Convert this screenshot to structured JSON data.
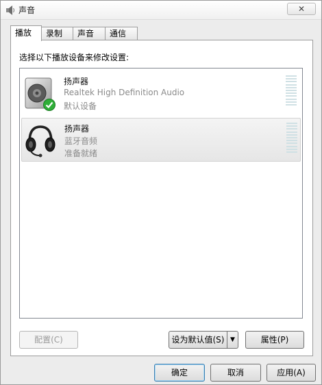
{
  "window": {
    "title": "声音",
    "close_label": "✕"
  },
  "tabs": [
    {
      "label": "播放",
      "active": true
    },
    {
      "label": "录制",
      "active": false
    },
    {
      "label": "声音",
      "active": false
    },
    {
      "label": "通信",
      "active": false
    }
  ],
  "panel": {
    "instruction": "选择以下播放设备来修改设置:"
  },
  "devices": [
    {
      "name": "扬声器",
      "description": "Realtek High Definition Audio",
      "status": "默认设备",
      "icon": "speaker-icon",
      "default": true
    },
    {
      "name": "扬声器",
      "description": "蓝牙音频",
      "status": "准备就绪",
      "icon": "headset-icon",
      "default": false
    }
  ],
  "buttons": {
    "configure": "配置(C)",
    "set_default": "设为默认值(S)",
    "properties": "属性(P)",
    "ok": "确定",
    "cancel": "取消",
    "apply": "应用(A)"
  },
  "colors": {
    "accent": "#3c7fb1",
    "check_green": "#2fae38"
  }
}
